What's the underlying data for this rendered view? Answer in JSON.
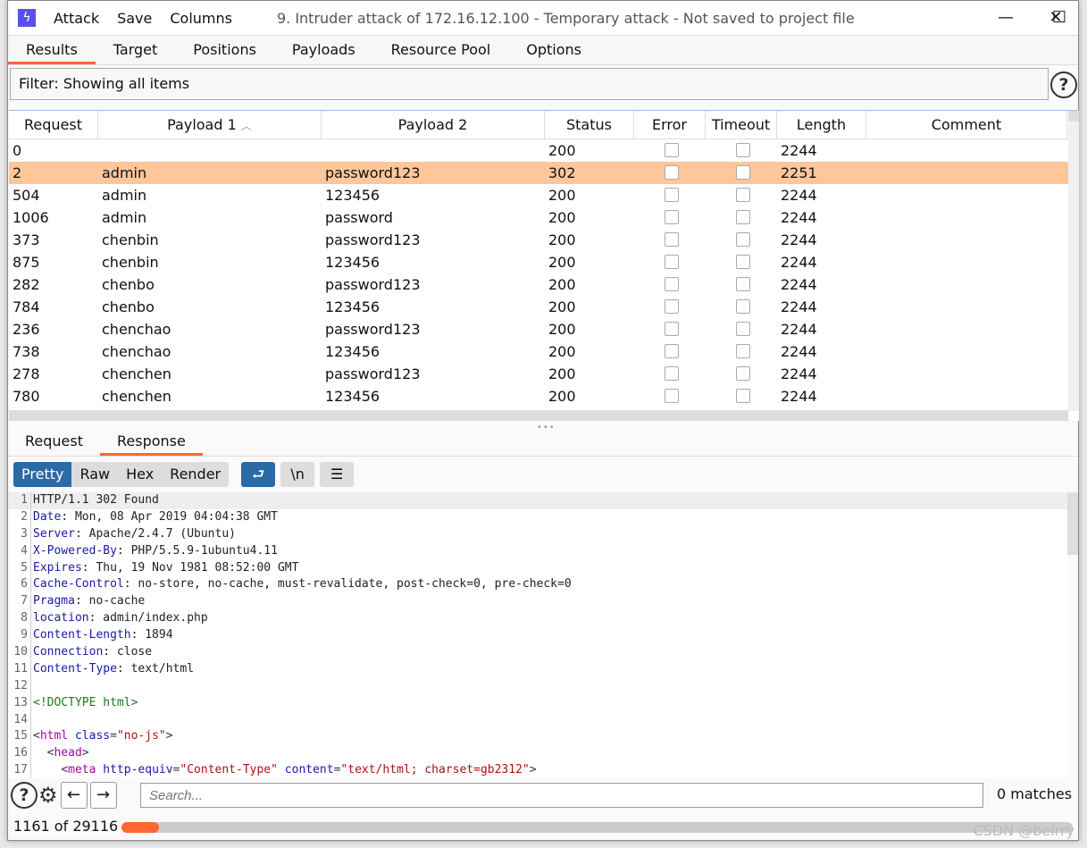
{
  "window": {
    "menu": [
      "Attack",
      "Save",
      "Columns"
    ],
    "title": "9. Intruder attack of 172.16.12.100 - Temporary attack - Not saved to project file",
    "controls": {
      "minimize": "—",
      "maximize": "☐",
      "close": "✕"
    }
  },
  "tabs": [
    "Results",
    "Target",
    "Positions",
    "Payloads",
    "Resource Pool",
    "Options"
  ],
  "active_tab": "Results",
  "filter": {
    "label": "Filter: Showing all items",
    "help": "?"
  },
  "table": {
    "columns": [
      "Request",
      "Payload 1",
      "Payload 2",
      "Status",
      "Error",
      "Timeout",
      "Length",
      "Comment"
    ],
    "sort_indicator": "^",
    "rows": [
      {
        "request": "0",
        "p1": "",
        "p2": "",
        "status": "200",
        "error": false,
        "timeout": false,
        "length": "2244",
        "comment": "",
        "selected": false
      },
      {
        "request": "2",
        "p1": "admin",
        "p2": "password123",
        "status": "302",
        "error": false,
        "timeout": false,
        "length": "2251",
        "comment": "",
        "selected": true
      },
      {
        "request": "504",
        "p1": "admin",
        "p2": "123456",
        "status": "200",
        "error": false,
        "timeout": false,
        "length": "2244",
        "comment": "",
        "selected": false
      },
      {
        "request": "1006",
        "p1": "admin",
        "p2": "password",
        "status": "200",
        "error": false,
        "timeout": false,
        "length": "2244",
        "comment": "",
        "selected": false
      },
      {
        "request": "373",
        "p1": "chenbin",
        "p2": "password123",
        "status": "200",
        "error": false,
        "timeout": false,
        "length": "2244",
        "comment": "",
        "selected": false
      },
      {
        "request": "875",
        "p1": "chenbin",
        "p2": "123456",
        "status": "200",
        "error": false,
        "timeout": false,
        "length": "2244",
        "comment": "",
        "selected": false
      },
      {
        "request": "282",
        "p1": "chenbo",
        "p2": "password123",
        "status": "200",
        "error": false,
        "timeout": false,
        "length": "2244",
        "comment": "",
        "selected": false
      },
      {
        "request": "784",
        "p1": "chenbo",
        "p2": "123456",
        "status": "200",
        "error": false,
        "timeout": false,
        "length": "2244",
        "comment": "",
        "selected": false
      },
      {
        "request": "236",
        "p1": "chenchao",
        "p2": "password123",
        "status": "200",
        "error": false,
        "timeout": false,
        "length": "2244",
        "comment": "",
        "selected": false
      },
      {
        "request": "738",
        "p1": "chenchao",
        "p2": "123456",
        "status": "200",
        "error": false,
        "timeout": false,
        "length": "2244",
        "comment": "",
        "selected": false
      },
      {
        "request": "278",
        "p1": "chenchen",
        "p2": "password123",
        "status": "200",
        "error": false,
        "timeout": false,
        "length": "2244",
        "comment": "",
        "selected": false
      },
      {
        "request": "780",
        "p1": "chenchen",
        "p2": "123456",
        "status": "200",
        "error": false,
        "timeout": false,
        "length": "2244",
        "comment": "",
        "selected": false
      }
    ]
  },
  "message_tabs": [
    "Request",
    "Response"
  ],
  "active_message_tab": "Response",
  "view_modes": [
    "Pretty",
    "Raw",
    "Hex",
    "Render"
  ],
  "active_view_mode": "Pretty",
  "toolbar_icons": {
    "wrap": "wrap-lines-icon",
    "newline": "\\n",
    "menu": "☰"
  },
  "code": [
    [
      [
        "v",
        "HTTP/1.1 302 Found"
      ]
    ],
    [
      [
        "k",
        "Date"
      ],
      [
        "v",
        ": Mon, 08 Apr 2019 04:04:38 GMT"
      ]
    ],
    [
      [
        "k",
        "Server"
      ],
      [
        "v",
        ": Apache/2.4.7 (Ubuntu)"
      ]
    ],
    [
      [
        "k",
        "X-Powered-By"
      ],
      [
        "v",
        ": PHP/5.5.9-1ubuntu4.11"
      ]
    ],
    [
      [
        "k",
        "Expires"
      ],
      [
        "v",
        ": Thu, 19 Nov 1981 08:52:00 GMT"
      ]
    ],
    [
      [
        "k",
        "Cache-Control"
      ],
      [
        "v",
        ": no-store, no-cache, must-revalidate, post-check=0, pre-check=0"
      ]
    ],
    [
      [
        "k",
        "Pragma"
      ],
      [
        "v",
        ": no-cache"
      ]
    ],
    [
      [
        "k",
        "location"
      ],
      [
        "v",
        ": admin/index.php"
      ]
    ],
    [
      [
        "k",
        "Content-Length"
      ],
      [
        "v",
        ": 1894"
      ]
    ],
    [
      [
        "k",
        "Connection"
      ],
      [
        "v",
        ": close"
      ]
    ],
    [
      [
        "k",
        "Content-Type"
      ],
      [
        "v",
        ": text/html"
      ]
    ],
    [],
    [
      [
        "g",
        "<!DOCTYPE html>"
      ]
    ],
    [],
    [
      [
        "d",
        "<"
      ],
      [
        "p",
        "html"
      ],
      [
        "v",
        " "
      ],
      [
        "a",
        "class"
      ],
      [
        "d",
        "="
      ],
      [
        "s",
        "\"no-js\""
      ],
      [
        "d",
        ">"
      ]
    ],
    [
      [
        "v",
        "  "
      ],
      [
        "d",
        "<"
      ],
      [
        "p",
        "head"
      ],
      [
        "d",
        ">"
      ]
    ],
    [
      [
        "v",
        "    "
      ],
      [
        "d",
        "<"
      ],
      [
        "p",
        "meta"
      ],
      [
        "v",
        " "
      ],
      [
        "a",
        "http-equiv"
      ],
      [
        "d",
        "="
      ],
      [
        "s",
        "\"Content-Type\""
      ],
      [
        "v",
        " "
      ],
      [
        "a",
        "content"
      ],
      [
        "d",
        "="
      ],
      [
        "s",
        "\"text/html; charset=gb2312\""
      ],
      [
        "d",
        ">"
      ]
    ]
  ],
  "search": {
    "placeholder": "Search...",
    "matches": "0 matches"
  },
  "progress": {
    "label": "1161 of 29116",
    "completed": 1161,
    "total": 29116,
    "color": "#ff6633"
  },
  "watermark": "CSDN @beirry",
  "colors": {
    "accent": "#ff6633",
    "selected_row": "#ffc69a",
    "active_button": "#2b6aa6",
    "logo": "#5b4ef0"
  }
}
